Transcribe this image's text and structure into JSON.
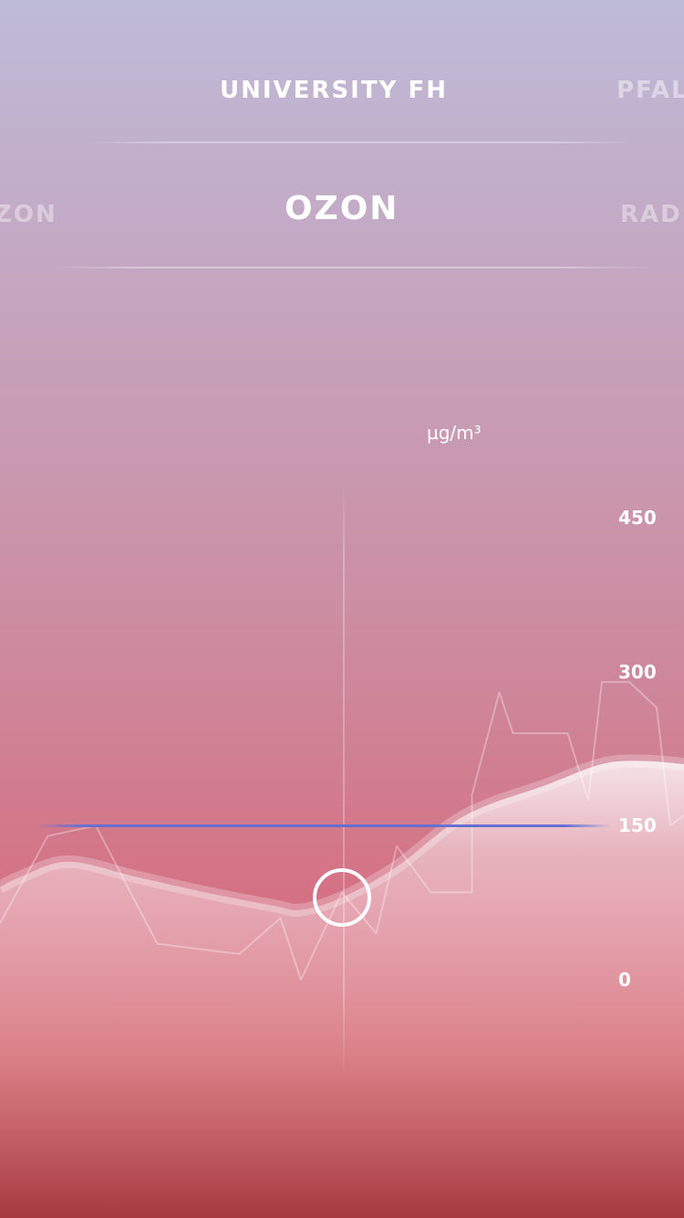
{
  "stations": [
    {
      "label": "UNIVERSITY FH",
      "state": "active"
    },
    {
      "label": "PFAL",
      "state": "next"
    }
  ],
  "metrics": [
    {
      "label": "ZON",
      "state": "prev"
    },
    {
      "label": "OZON",
      "state": "active"
    },
    {
      "label": "RAD",
      "state": "next"
    }
  ],
  "colors": {
    "accent_threshold": "#6670d4",
    "bg_top": "#bebbd8",
    "bg_bottom": "#a63a40"
  },
  "chart_data": {
    "type": "area",
    "unit": "µg/m³",
    "ylim": [
      0,
      450
    ],
    "y_ticks": [
      "450",
      "300",
      "150",
      "0"
    ],
    "threshold": 150,
    "cursor_value": 80,
    "smooth_series": [
      [
        0,
        90
      ],
      [
        3,
        100
      ],
      [
        10,
        115
      ],
      [
        20,
        100
      ],
      [
        30,
        85
      ],
      [
        40,
        72
      ],
      [
        44,
        68
      ],
      [
        50,
        80
      ],
      [
        58,
        110
      ],
      [
        68,
        160
      ],
      [
        80,
        190
      ],
      [
        88,
        210
      ],
      [
        94,
        213
      ],
      [
        100,
        210
      ]
    ],
    "raw_series": [
      [
        0,
        55
      ],
      [
        7,
        140
      ],
      [
        14,
        150
      ],
      [
        23,
        35
      ],
      [
        35,
        25
      ],
      [
        41,
        60
      ],
      [
        44,
        0
      ],
      [
        50,
        85
      ],
      [
        55,
        45
      ],
      [
        58,
        130
      ],
      [
        63,
        85
      ],
      [
        69,
        85
      ],
      [
        69,
        180
      ],
      [
        73,
        280
      ],
      [
        75,
        240
      ],
      [
        83,
        240
      ],
      [
        86,
        175
      ],
      [
        88,
        290
      ],
      [
        92,
        290
      ],
      [
        96,
        265
      ],
      [
        98,
        150
      ],
      [
        100,
        160
      ]
    ]
  }
}
